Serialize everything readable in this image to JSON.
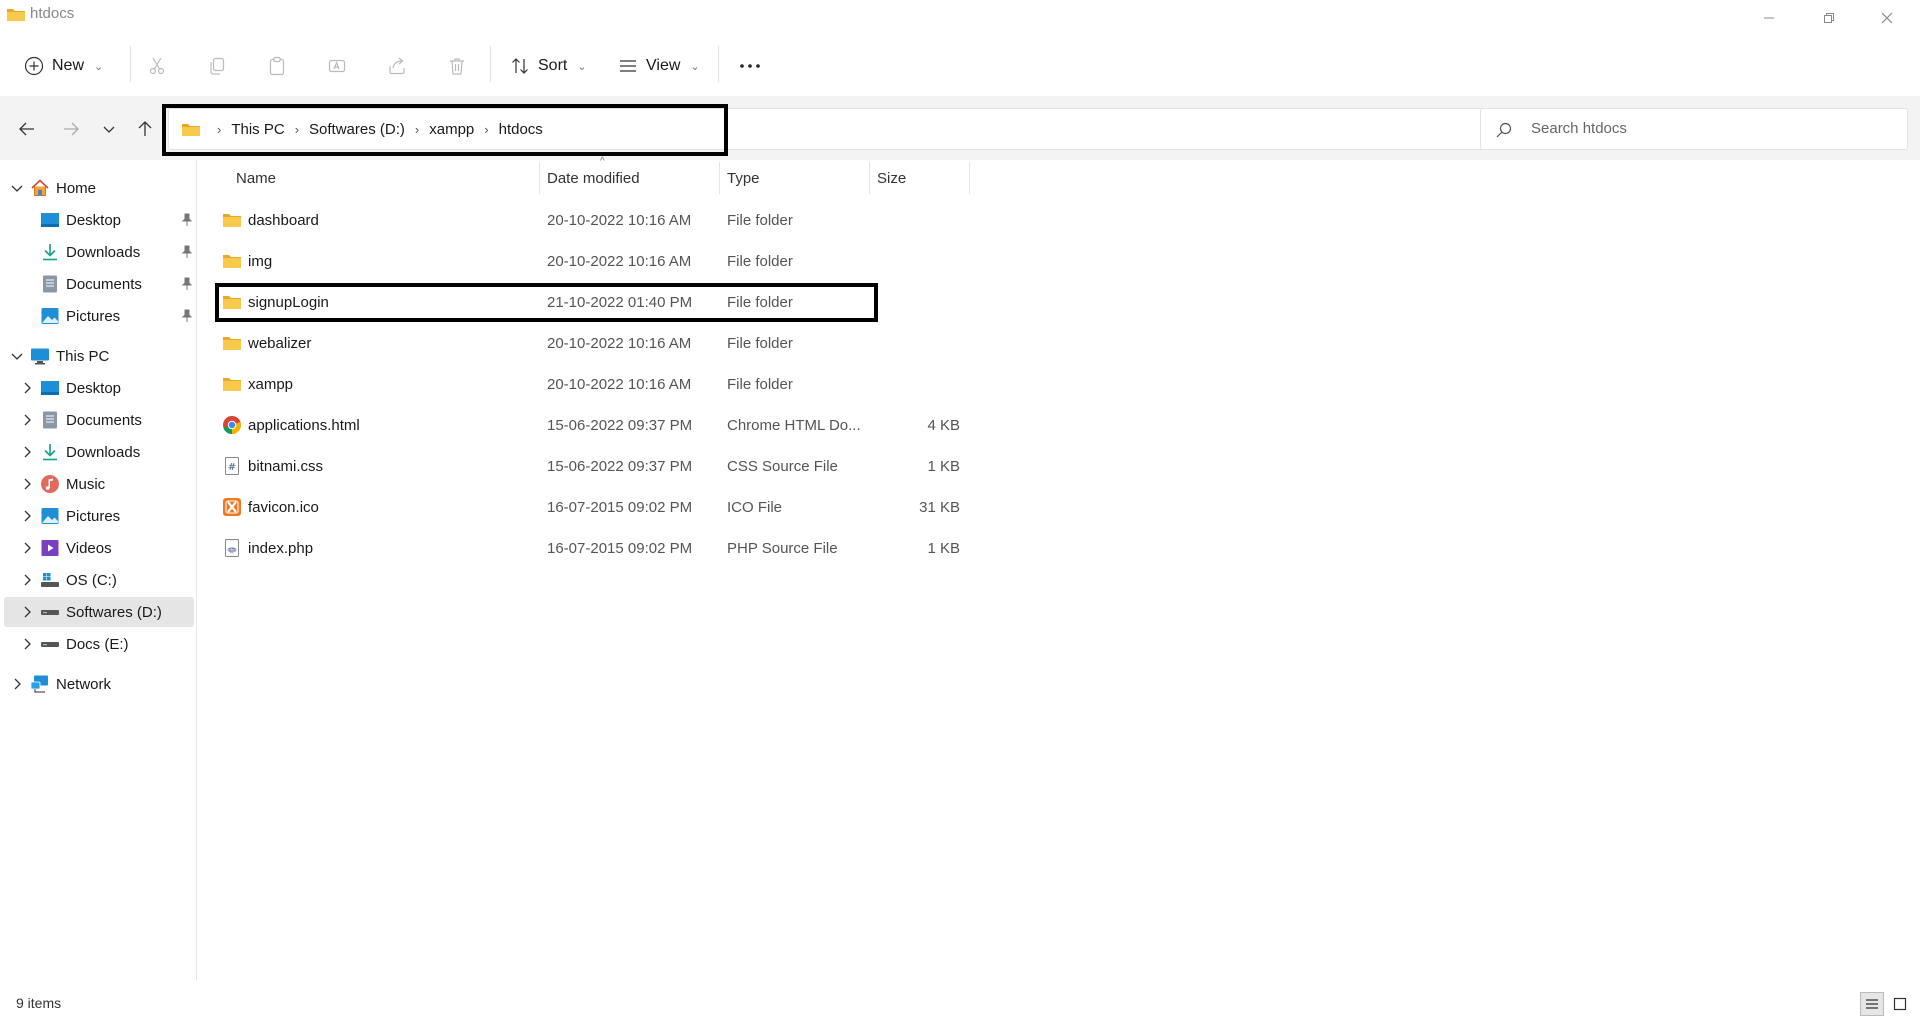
{
  "window": {
    "title": "htdocs"
  },
  "toolbar": {
    "new_label": "New",
    "sort_label": "Sort",
    "view_label": "View",
    "more_label": "···"
  },
  "address": {
    "crumbs": [
      "This PC",
      "Softwares (D:)",
      "xampp",
      "htdocs"
    ]
  },
  "search": {
    "placeholder": "Search htdocs"
  },
  "sidebar": {
    "home": "Home",
    "quick_access": [
      "Desktop",
      "Downloads",
      "Documents",
      "Pictures"
    ],
    "this_pc": "This PC",
    "this_pc_items": [
      "Desktop",
      "Documents",
      "Downloads",
      "Music",
      "Pictures",
      "Videos",
      "OS (C:)",
      "Softwares (D:)",
      "Docs (E:)"
    ],
    "network": "Network"
  },
  "columns": {
    "name": "Name",
    "date": "Date modified",
    "type": "Type",
    "size": "Size"
  },
  "files": [
    {
      "name": "dashboard",
      "date": "20-10-2022 10:16 AM",
      "type": "File folder",
      "size": "",
      "icon": "folder-icon"
    },
    {
      "name": "img",
      "date": "20-10-2022 10:16 AM",
      "type": "File folder",
      "size": "",
      "icon": "folder-icon"
    },
    {
      "name": "signupLogin",
      "date": "21-10-2022 01:40 PM",
      "type": "File folder",
      "size": "",
      "icon": "folder-icon"
    },
    {
      "name": "webalizer",
      "date": "20-10-2022 10:16 AM",
      "type": "File folder",
      "size": "",
      "icon": "folder-icon"
    },
    {
      "name": "xampp",
      "date": "20-10-2022 10:16 AM",
      "type": "File folder",
      "size": "",
      "icon": "folder-icon"
    },
    {
      "name": "applications.html",
      "date": "15-06-2022 09:37 PM",
      "type": "Chrome HTML Do...",
      "size": "4 KB",
      "icon": "chrome-icon"
    },
    {
      "name": "bitnami.css",
      "date": "15-06-2022 09:37 PM",
      "type": "CSS Source File",
      "size": "1 KB",
      "icon": "css-file-icon"
    },
    {
      "name": "favicon.ico",
      "date": "16-07-2015 09:02 PM",
      "type": "ICO File",
      "size": "31 KB",
      "icon": "xampp-icon"
    },
    {
      "name": "index.php",
      "date": "16-07-2015 09:02 PM",
      "type": "PHP Source File",
      "size": "1 KB",
      "icon": "php-file-icon"
    }
  ],
  "status": {
    "count": "9 items"
  },
  "colors": {
    "folder": "#f8c94a",
    "folder_dark": "#e8a92a",
    "accent": "#0067c0",
    "highlight_border": "#000000"
  }
}
